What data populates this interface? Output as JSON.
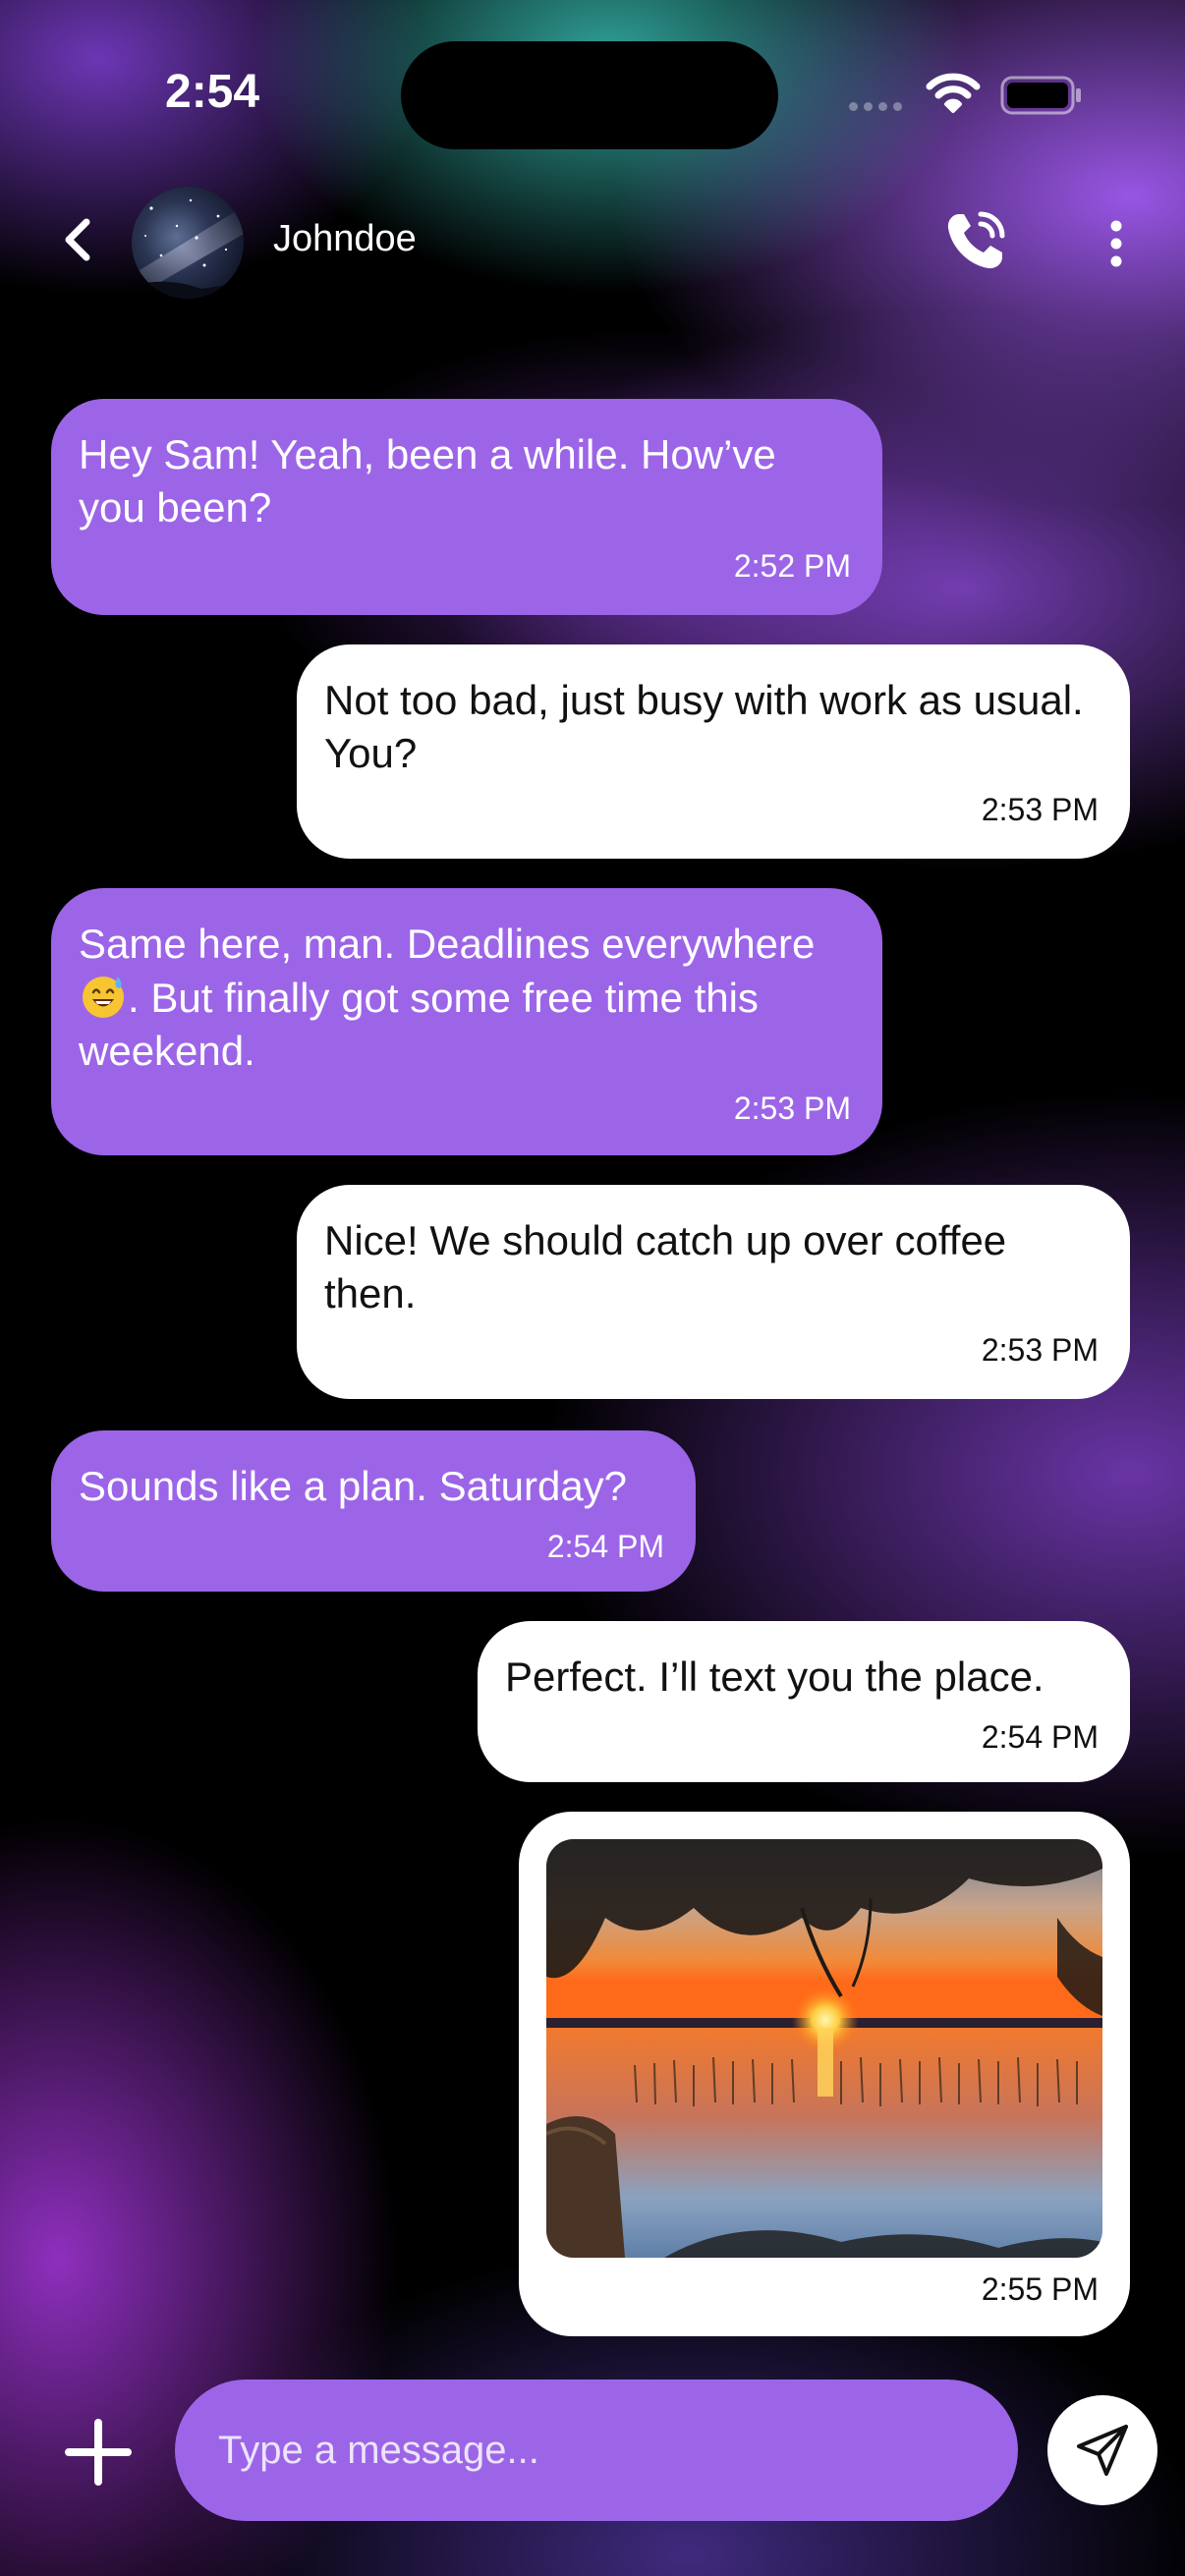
{
  "status_bar": {
    "time": "2:54"
  },
  "header": {
    "contact_name": "Johndoe",
    "icons": [
      "back-icon",
      "avatar",
      "phone-call-icon",
      "more-vertical-icon"
    ]
  },
  "messages": [
    {
      "direction": "received",
      "text": "Hey Sam! Yeah, been a while. How’ve you been?",
      "time": "2:52 PM"
    },
    {
      "direction": "sent",
      "text": "Not too bad, just busy with work as usual. You?",
      "time": "2:53 PM"
    },
    {
      "direction": "received",
      "text_before": "Same here, man. Deadlines everywhere",
      "emoji": "sweat-smile-emoji",
      "text_after": ". But finally got some free time this weekend.",
      "time": "2:53 PM"
    },
    {
      "direction": "sent",
      "text": "Nice! We should catch up over coffee then.",
      "time": "2:53 PM"
    },
    {
      "direction": "received",
      "text": "Sounds like a plan. Saturday?",
      "time": "2:54 PM"
    },
    {
      "direction": "sent",
      "text": "Perfect. I’ll text you the place.",
      "time": "2:54 PM"
    },
    {
      "direction": "sent",
      "type": "image",
      "image": "sunset-over-lake-photo",
      "time": "2:55 PM"
    }
  ],
  "composer": {
    "placeholder": "Type a message...",
    "add_icon": "plus-icon",
    "send_icon": "send-icon"
  },
  "colors": {
    "received_bubble": "#9c65e8",
    "sent_bubble": "#ffffff",
    "input_background": "#9c65e8"
  }
}
